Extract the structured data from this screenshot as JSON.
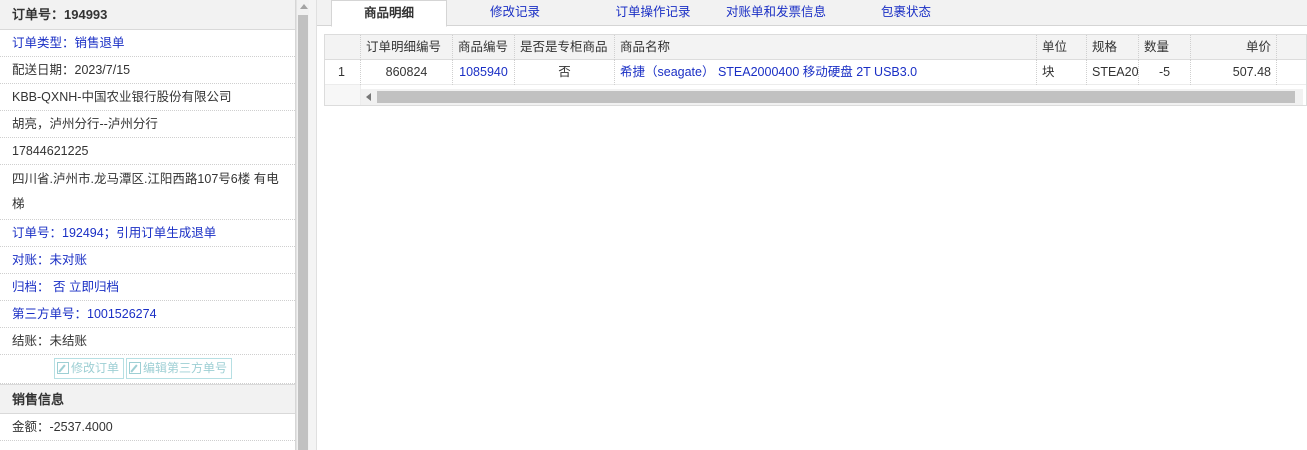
{
  "left": {
    "order_header": "订单号：194993",
    "rows": [
      {
        "text": "订单类型：销售退单",
        "blue": true
      },
      {
        "text": "配送日期：2023/7/15",
        "blue": false
      },
      {
        "text": "KBB-QXNH-中国农业银行股份有限公司",
        "blue": false
      },
      {
        "text": "胡亮，泸州分行--泸州分行",
        "blue": false
      },
      {
        "text": "17844621225",
        "blue": false
      }
    ],
    "address": "四川省.泸州市.龙马潭区.江阳西路107号6楼 有电梯",
    "rows2": [
      {
        "text": "订单号：192494；引用订单生成退单",
        "blue": true
      },
      {
        "text": "对账：未对账",
        "blue": true
      },
      {
        "text": "归档：  否 立即归档",
        "blue": true
      },
      {
        "text": "第三方单号：1001526274",
        "blue": true
      },
      {
        "text": "结账：未结账",
        "blue": false
      }
    ],
    "buttons": {
      "edit_order": "修改订单",
      "edit_third_party": "编辑第三方单号"
    },
    "sales_header": "销售信息",
    "amount": "金额：-2537.4000"
  },
  "tabs": [
    "商品明细",
    "修改记录",
    "订单操作记录",
    "对账单和发票信息",
    "包裹状态"
  ],
  "active_tab": 0,
  "grid": {
    "headers": [
      "订单明细编号",
      "商品编号",
      "是否是专柜商品",
      "商品名称",
      "单位",
      "规格",
      "数量",
      "单价"
    ],
    "rows": [
      {
        "index": "1",
        "detail_no": "860824",
        "product_no": "1085940",
        "is_counter": "否",
        "name": "希捷（seagate） STEA2000400 移动硬盘 2T USB3.0",
        "unit": "块",
        "spec": "STEA20",
        "qty": "-5",
        "price": "507.48"
      }
    ]
  },
  "colors": {
    "link": "#1a2fc5",
    "disabled_btn": "#9ecfd4"
  }
}
